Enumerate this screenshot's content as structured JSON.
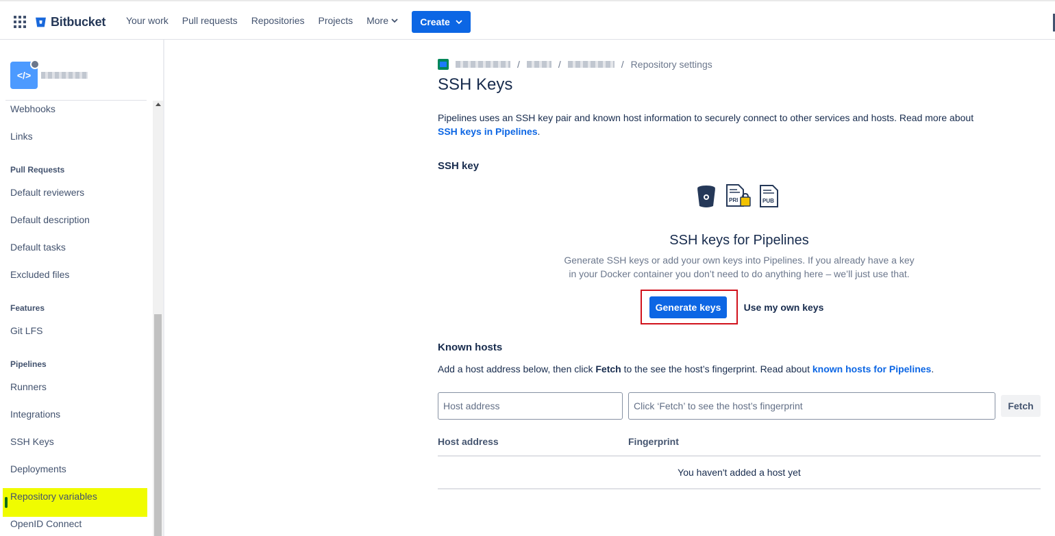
{
  "topnav": {
    "brand": "Bitbucket",
    "items": [
      "Your work",
      "Pull requests",
      "Repositories",
      "Projects"
    ],
    "more_label": "More",
    "create_label": "Create"
  },
  "sidebar": {
    "items": [
      {
        "label": "Webhooks",
        "kind": "item"
      },
      {
        "label": "Links",
        "kind": "item"
      },
      {
        "label": "Pull Requests",
        "kind": "heading"
      },
      {
        "label": "Default reviewers",
        "kind": "item"
      },
      {
        "label": "Default description",
        "kind": "item"
      },
      {
        "label": "Default tasks",
        "kind": "item"
      },
      {
        "label": "Excluded files",
        "kind": "item"
      },
      {
        "label": "Features",
        "kind": "heading"
      },
      {
        "label": "Git LFS",
        "kind": "item"
      },
      {
        "label": "Pipelines",
        "kind": "heading"
      },
      {
        "label": "Runners",
        "kind": "item"
      },
      {
        "label": "Integrations",
        "kind": "item"
      },
      {
        "label": "SSH Keys",
        "kind": "item",
        "active": true
      },
      {
        "label": "Deployments",
        "kind": "item"
      },
      {
        "label": "Repository variables",
        "kind": "item"
      },
      {
        "label": "OpenID Connect",
        "kind": "item"
      }
    ],
    "avatar_icon": "code-icon"
  },
  "breadcrumb": {
    "separator": "/",
    "current": "Repository settings"
  },
  "page": {
    "title": "SSH Keys",
    "intro": "Pipelines uses an SSH key pair and known host information to securely connect to other services and hosts. Read more about ",
    "intro_link": "SSH keys in Pipelines",
    "intro_end": "."
  },
  "ssh_key": {
    "heading": "SSH key",
    "icons": [
      "bucket-icon",
      "private-key-icon",
      "public-key-icon"
    ],
    "pri_label": "PRI",
    "pub_label": "PUB",
    "empty_title": "SSH keys for Pipelines",
    "empty_desc": "Generate SSH keys or add your own keys into Pipelines. If you already have a key in your Docker container you don’t need to do anything here – we’ll just use that.",
    "generate_label": "Generate keys",
    "own_label": "Use my own keys"
  },
  "known_hosts": {
    "heading": "Known hosts",
    "desc_before": "Add a host address below, then click ",
    "desc_bold": "Fetch",
    "desc_middle": " to the see the host’s fingerprint. Read about ",
    "desc_link": "known hosts for Pipelines",
    "desc_end": ".",
    "host_placeholder": "Host address",
    "fingerprint_placeholder": "Click ‘Fetch’ to see the host’s fingerprint",
    "fetch_label": "Fetch",
    "col_host": "Host address",
    "col_fingerprint": "Fingerprint",
    "empty": "You haven't added a host yet"
  },
  "colors": {
    "primary": "#0c66e4",
    "highlight": "#f0fc00",
    "callout_border": "#d1111b"
  }
}
